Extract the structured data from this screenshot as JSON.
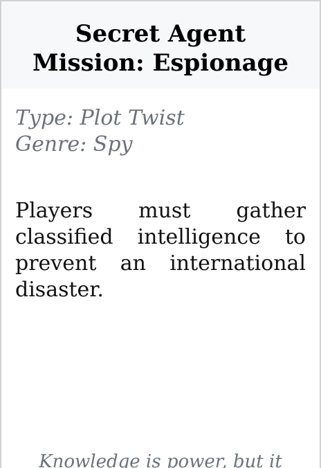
{
  "card": {
    "title_line1": "Secret Agent",
    "title_line2": "Mission: Espionage",
    "type_line": "Type: Plot Twist",
    "genre_line": "Genre: Spy",
    "description": "Players must gather classified intelligence to prevent an international disaster.",
    "flavor_text_visible": "Knowledge is power, but it"
  },
  "colors": {
    "header_background": "#f7f8fa",
    "border": "#cfd1d4",
    "muted_text": "#6c727a",
    "body_text": "#111111"
  }
}
